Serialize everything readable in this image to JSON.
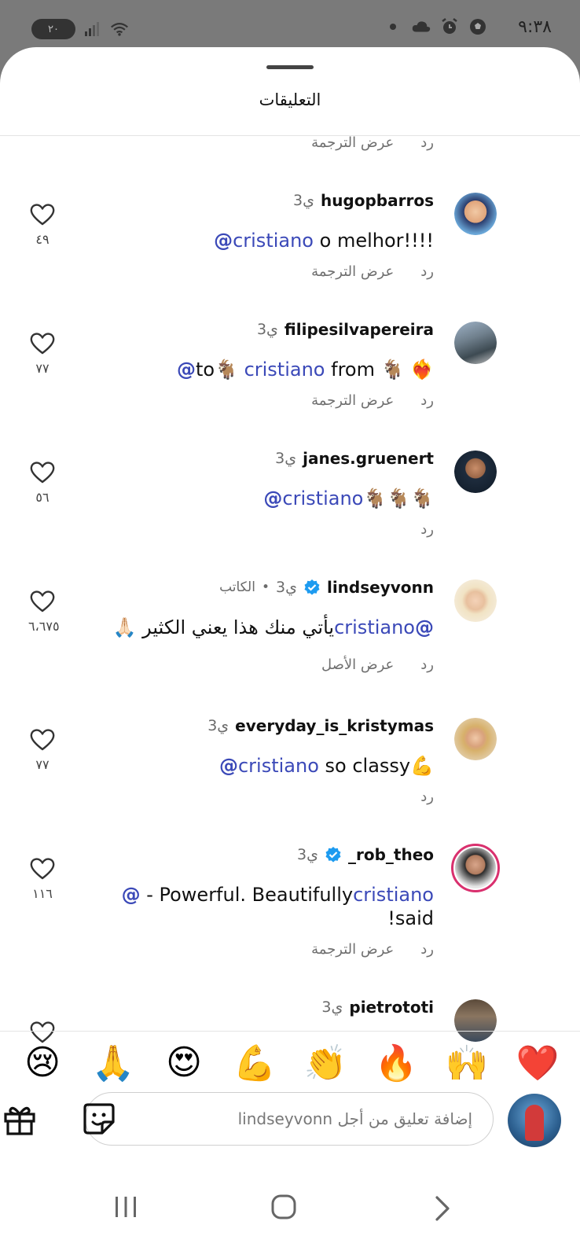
{
  "status_bar": {
    "time": "٩:٣٨",
    "battery": "٢٠"
  },
  "sheet": {
    "title": "التعليقات"
  },
  "actions": {
    "reply": "رد",
    "see_translation": "عرض الترجمة",
    "see_original": "عرض الأصل"
  },
  "top_partial_meta": {
    "reply": "رد",
    "extra": "عرض الترجمة"
  },
  "comments": [
    {
      "username": "hugopbarros",
      "age": "3ي",
      "mention": "cristiano",
      "text": " o melhor!!!!",
      "likes": "٤٩",
      "extra_action": "عرض الترجمة"
    },
    {
      "username": "filipesilvapereira",
      "age": "3ي",
      "mention": "cristiano",
      "text_before": "to🐐 ",
      "text_middle": " from 🐐 ",
      "text_after": "❤️‍🔥",
      "likes": "٧٧",
      "extra_action": "عرض الترجمة"
    },
    {
      "username": "janes.gruenert",
      "age": "3ي",
      "mention": "cristiano",
      "text": "🐐🐐🐐",
      "likes": "٥٦"
    },
    {
      "username": "lindseyvonn",
      "age": "3ي",
      "verified": true,
      "author_tag": "الكاتب",
      "mention": "cristiano",
      "text": "يأتي منك هذا يعني الكثير 🙏🏻",
      "likes": "٦،٦٧٥",
      "extra_action": "عرض الأصل"
    },
    {
      "username": "everyday_is_kristymas",
      "age": "3ي",
      "mention": "cristiano",
      "text": " so classy💪",
      "likes": "٧٧"
    },
    {
      "username": "_rob_theo",
      "age": "3ي",
      "verified": true,
      "mention": "cristiano",
      "text_line1": " - Powerful. Beautifully",
      "text_line2": "!said",
      "likes": "١١٦",
      "extra_action": "عرض الترجمة"
    },
    {
      "username": "pietrototi",
      "age": "3ي"
    }
  ],
  "reactions": [
    "😢",
    "🙏",
    "😍",
    "💪",
    "👏",
    "🔥",
    "🙌",
    "❤️"
  ],
  "composer": {
    "placeholder": "إضافة تعليق من أجل lindseyvonn"
  },
  "icons": {
    "like": "heart-outline-icon",
    "sticker": "sticker-icon",
    "gift": "gift-icon",
    "threads": "threads-icon"
  }
}
